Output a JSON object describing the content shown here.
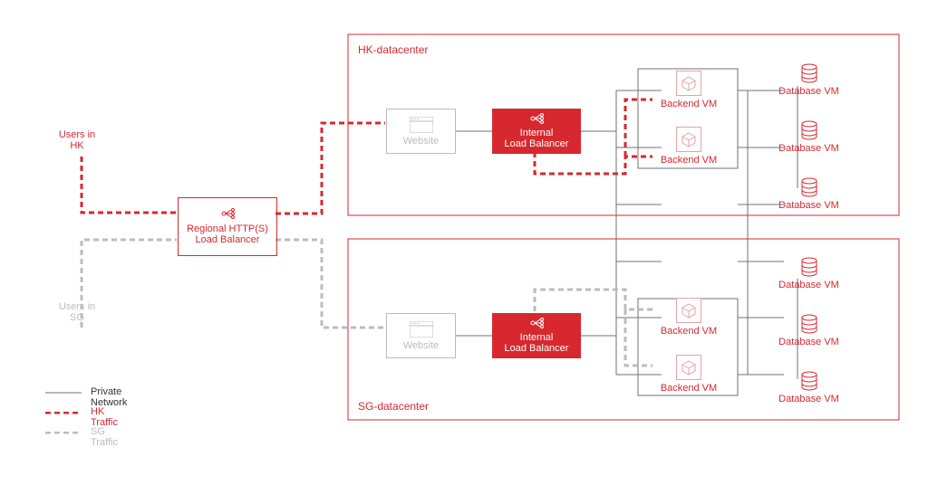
{
  "users_hk": "Users in\nHK",
  "users_sg": "Users in\nSG",
  "regional_lb": "Regional HTTP(S)\nLoad Balancer",
  "website": "Website",
  "internal_lb": "Internal\nLoad Balancer",
  "backend_vm": "Backend VM",
  "database_vm": "Database VM",
  "dc_hk": "HK-datacenter",
  "dc_sg": "SG-datacenter",
  "legend": {
    "private": "Private Network",
    "hk": "HK Traffic",
    "sg": "SG Traffic"
  },
  "colors": {
    "red": "#d7282f",
    "gray": "#bcbcbc",
    "darkgray": "#707070"
  }
}
